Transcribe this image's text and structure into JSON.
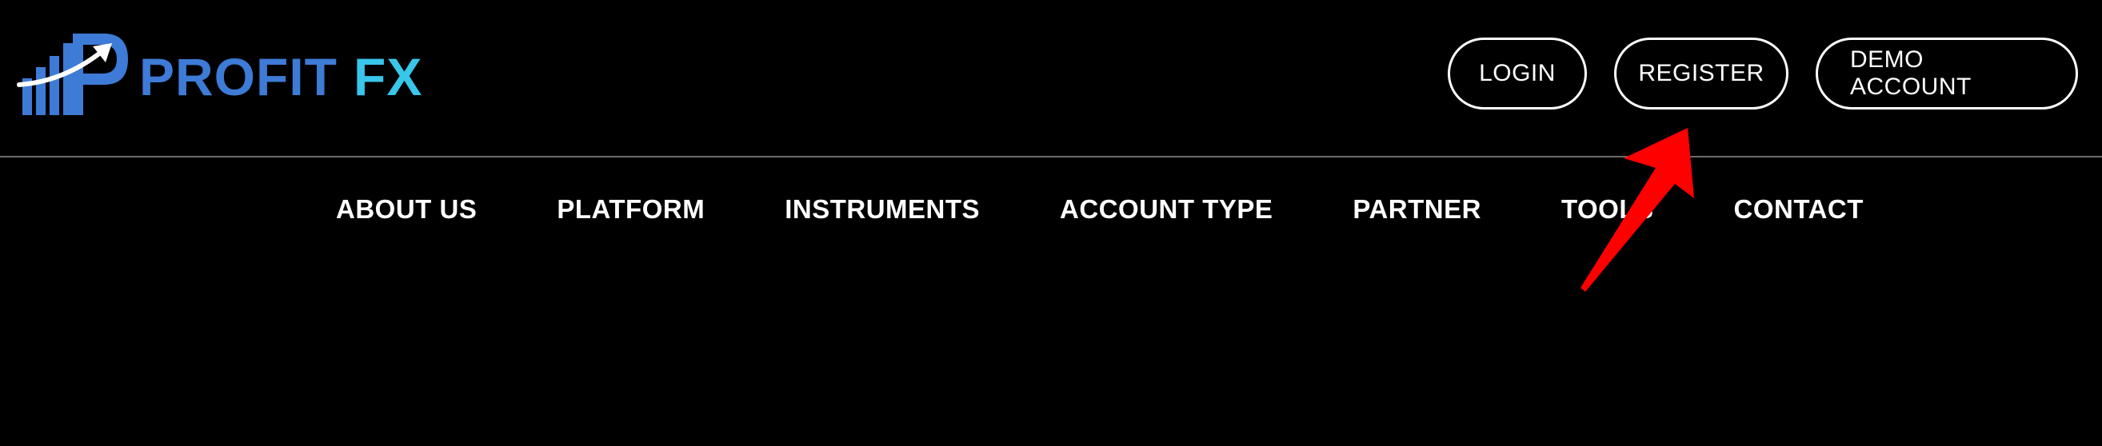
{
  "brand": {
    "name_part1": "PROFIT",
    "name_part2": "FX",
    "colors": {
      "primary_blue": "#3d7bd6",
      "accent_cyan": "#38c6ea"
    }
  },
  "auth": {
    "login_label": "LOGIN",
    "register_label": "REGISTER",
    "demo_label": "DEMO ACCOUNT"
  },
  "nav": {
    "items": [
      {
        "label": "ABOUT US"
      },
      {
        "label": "PLATFORM"
      },
      {
        "label": "INSTRUMENTS"
      },
      {
        "label": "ACCOUNT TYPE"
      },
      {
        "label": "PARTNER"
      },
      {
        "label": "TOOLS"
      },
      {
        "label": "CONTACT"
      }
    ]
  },
  "annotation": {
    "icon": "red-arrow-icon",
    "color": "#ff0000"
  },
  "theme": {
    "background": "#000000",
    "text": "#ffffff",
    "divider": "#6b6b6b"
  }
}
